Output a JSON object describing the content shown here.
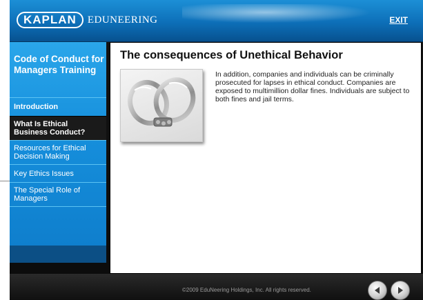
{
  "header": {
    "logo_kaplan": "KAPLAN",
    "logo_edu": "EDUNEERING",
    "exit_label": "EXIT"
  },
  "sidebar": {
    "course_title": "Code of Conduct for Managers Training",
    "items": [
      {
        "label": "Introduction"
      },
      {
        "label": "What Is Ethical Business Conduct?"
      },
      {
        "label": "Resources for Ethical Decision Making"
      },
      {
        "label": "Key Ethics Issues"
      },
      {
        "label": "The Special Role of Managers"
      }
    ]
  },
  "content": {
    "title": "The consequences of Unethical Behavior",
    "body": "In addition, companies and individuals can be criminally prosecuted for lapses in ethical conduct. Companies are exposed to multimillion dollar fines. Individuals are subject to both fines and jail terms.",
    "image": "handcuffs-photo"
  },
  "footer": {
    "copyright": "©2009 EduNeering Holdings, Inc. All rights reserved."
  },
  "icons": {
    "prev": "arrow-left-icon",
    "next": "arrow-right-icon"
  }
}
